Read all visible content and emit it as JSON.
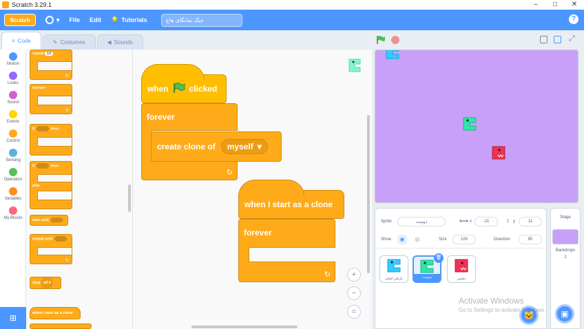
{
  "window": {
    "title": "Scratch 3.29.1",
    "minimize": "–",
    "maximize": "□",
    "close": "✕"
  },
  "menubar": {
    "logo": "Scratch",
    "file": "File",
    "edit": "Edit",
    "tutorials": "Tutorials",
    "project_title": "جنگ شانگای هاج",
    "help": "?"
  },
  "tabs": [
    {
      "label": "Code",
      "icon": "code-icon"
    },
    {
      "label": "Costumes",
      "icon": "brush-icon"
    },
    {
      "label": "Sounds",
      "icon": "speaker-icon"
    }
  ],
  "categories": [
    {
      "label": "Motion",
      "color": "#4c97ff"
    },
    {
      "label": "Looks",
      "color": "#9966ff"
    },
    {
      "label": "Sound",
      "color": "#cf63cf"
    },
    {
      "label": "Events",
      "color": "#ffd500"
    },
    {
      "label": "Control",
      "color": "#ffab19"
    },
    {
      "label": "Sensing",
      "color": "#5cb1d6"
    },
    {
      "label": "Operators",
      "color": "#59c059"
    },
    {
      "label": "Variables",
      "color": "#ff8c1a"
    },
    {
      "label": "My Blocks",
      "color": "#ff6680"
    }
  ],
  "palette": {
    "repeat": "repeat",
    "repeat_count": "10",
    "forever": "forever",
    "if_then": "if",
    "then": "then",
    "if_else_if": "if",
    "if_else_then": "then",
    "else": "else",
    "wait_until": "wait until",
    "repeat_until": "repeat until",
    "stop": "stop",
    "stop_option": "all ▾",
    "clone_hat": "when I start as a clone"
  },
  "script1": {
    "hat_when": "when",
    "hat_clicked": "clicked",
    "forever": "forever",
    "create_clone": "create clone of",
    "clone_target": "myself"
  },
  "script2": {
    "hat": "when I start as a clone",
    "forever": "forever"
  },
  "zoom": {
    "in": "+",
    "out": "−",
    "reset": "="
  },
  "sprite_info": {
    "sprite_label": "Sprite",
    "sprite_name": "دوست",
    "x_label": "x",
    "x_value": "-21",
    "y_label": "y",
    "y_value": "11",
    "show_label": "Show",
    "size_label": "Size",
    "size_value": "100",
    "direction_label": "Direction",
    "direction_value": "90"
  },
  "sprites": [
    {
      "name": "بازیکن اصلی",
      "color": "#33ccff"
    },
    {
      "name": "دوست",
      "color": "#2ee6a8"
    },
    {
      "name": "دشمن",
      "color": "#ee3355"
    }
  ],
  "stage_panel": {
    "label": "Stage",
    "backdrops_label": "Backdrops",
    "backdrops_count": "2"
  },
  "watermark": {
    "line1": "Activate Windows",
    "line2": "Go to Settings to activate Windows."
  },
  "colors": {
    "stage_bg": "#c8a0f9",
    "accent": "#4c97ff",
    "control": "#ffab19",
    "events": "#ffbf00"
  }
}
